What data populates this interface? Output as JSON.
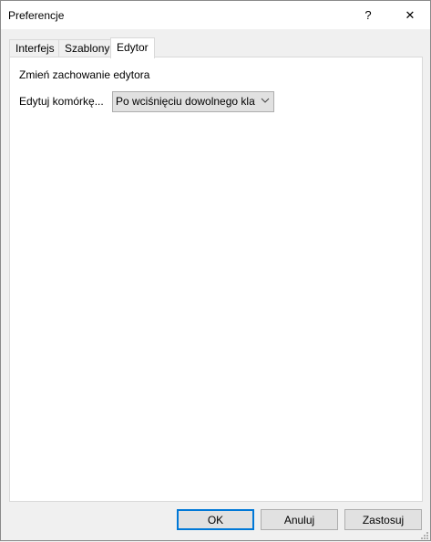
{
  "window": {
    "title": "Preferencje",
    "help_label": "?",
    "close_label": "✕"
  },
  "tabs": [
    {
      "label": "Interfejs"
    },
    {
      "label": "Szablony"
    },
    {
      "label": "Edytor",
      "active": true
    }
  ],
  "editor": {
    "section_title": "Zmień zachowanie edytora",
    "edit_cell_label": "Edytuj komórkę...",
    "edit_cell_value": "Po wciśnięciu dowolnego klawisza"
  },
  "buttons": {
    "ok": "OK",
    "cancel": "Anuluj",
    "apply": "Zastosuj"
  },
  "colors": {
    "accent": "#0078d7",
    "panel_bg": "#ffffff",
    "window_bg": "#f0f0f0"
  }
}
